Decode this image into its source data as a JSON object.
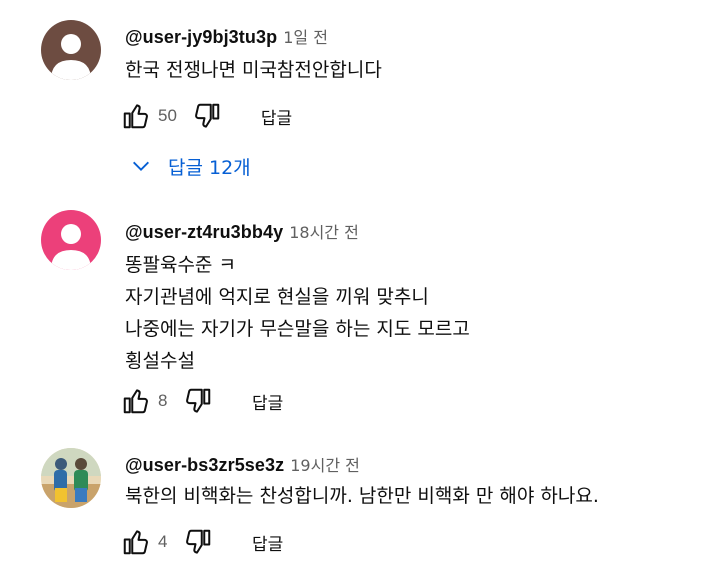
{
  "comments": [
    {
      "username": "@user-jy9bj3tu3p",
      "time": "1일 전",
      "text": "한국 전쟁나면 미국참전안합니다",
      "likes": "50",
      "reply_label": "답글",
      "avatar_color": "#6d4c41",
      "replies_label": "답글 12개"
    },
    {
      "username": "@user-zt4ru3bb4y",
      "time": "18시간 전",
      "lines": [
        "똥팔육수준 ㅋ",
        "자기관념에 억지로 현실을 끼워 맞추니",
        "나중에는 자기가 무슨말을 하는 지도 모르고",
        "횡설수설"
      ],
      "likes": "8",
      "reply_label": "답글",
      "avatar_color": "#ec407a"
    },
    {
      "username": "@user-bs3zr5se3z",
      "time": "19시간 전",
      "text": "북한의 비핵화는 찬성합니까. 남한만 비핵화 만 해야 하나요.",
      "likes": "4",
      "reply_label": "답글"
    }
  ],
  "colors": {
    "link_blue": "#065fd4",
    "secondary_text": "#606060"
  },
  "icons": {
    "like": "thumbs-up-icon",
    "dislike": "thumbs-down-icon",
    "expand": "chevron-down-icon"
  }
}
